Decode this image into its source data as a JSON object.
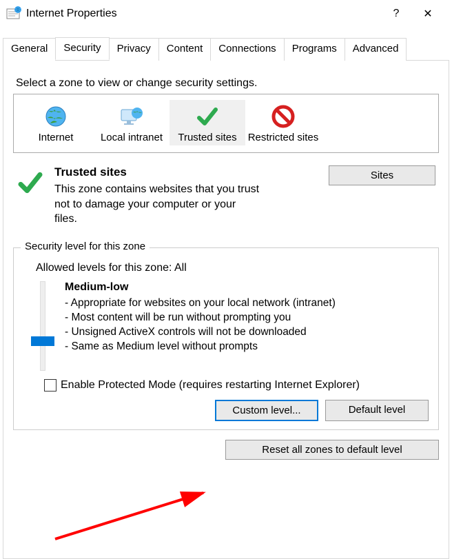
{
  "window": {
    "title": "Internet Properties",
    "help_glyph": "?",
    "close_glyph": "✕"
  },
  "tabs": [
    "General",
    "Security",
    "Privacy",
    "Content",
    "Connections",
    "Programs",
    "Advanced"
  ],
  "active_tab": "Security",
  "zone_section": {
    "prompt": "Select a zone to view or change security settings.",
    "zones": [
      {
        "label": "Internet"
      },
      {
        "label": "Local intranet"
      },
      {
        "label": "Trusted sites"
      },
      {
        "label": "Restricted sites"
      }
    ],
    "selected_index": 2
  },
  "zone_desc": {
    "title": "Trusted sites",
    "body": "This zone contains websites that you trust not to damage your computer or your files.",
    "sites_button": "Sites"
  },
  "level_group": {
    "title": "Security level for this zone",
    "allowed": "Allowed levels for this zone: All",
    "level_name": "Medium-low",
    "details": [
      "- Appropriate for websites on your local network (intranet)",
      "- Most content will be run without prompting you",
      "- Unsigned ActiveX controls will not be downloaded",
      "- Same as Medium level without prompts"
    ],
    "protected_mode": "Enable Protected Mode (requires restarting Internet Explorer)",
    "custom_button": "Custom level...",
    "default_button": "Default level"
  },
  "reset_button": "Reset all zones to default level"
}
